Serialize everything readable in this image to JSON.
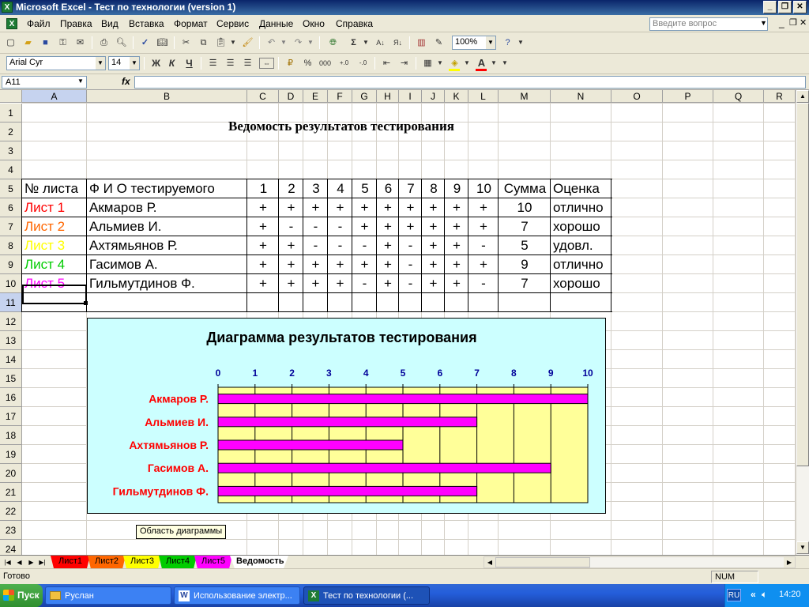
{
  "window": {
    "title": "Microsoft Excel - Тест по технологии  (version 1)"
  },
  "menu": {
    "items": [
      "Файл",
      "Правка",
      "Вид",
      "Вставка",
      "Формат",
      "Сервис",
      "Данные",
      "Окно",
      "Справка"
    ],
    "help_placeholder": "Введите вопрос"
  },
  "toolbar": {
    "zoom": "100%",
    "font": "Arial Cyr",
    "size": "14",
    "bold": "Ж",
    "italic": "К",
    "underline": "Ч",
    "percent": "%",
    "thousands": "000",
    "font_color_letter": "A",
    "sigma": "Σ"
  },
  "formula_bar": {
    "name_box": "A11",
    "fx": "fx",
    "content": ""
  },
  "columns": [
    "A",
    "B",
    "C",
    "D",
    "E",
    "F",
    "G",
    "H",
    "I",
    "J",
    "K",
    "L",
    "M",
    "N",
    "O",
    "P",
    "Q",
    "R"
  ],
  "rows": [
    "1",
    "2",
    "3",
    "4",
    "5",
    "6",
    "7",
    "8",
    "9",
    "10",
    "11",
    "12",
    "13",
    "14",
    "15",
    "16",
    "17",
    "18",
    "19",
    "20",
    "21",
    "22",
    "23",
    "24"
  ],
  "sheet": {
    "title": "Ведомость результатов тестирования",
    "header": [
      "№ листа",
      "Ф И О тестируемого",
      "1",
      "2",
      "3",
      "4",
      "5",
      "6",
      "7",
      "8",
      "9",
      "10",
      "Сумма",
      "Оценка"
    ],
    "rows": [
      {
        "sheet": "Лист 1",
        "color": "#ff0000",
        "name": "Акмаров Р.",
        "marks": [
          "+",
          "+",
          "+",
          "+",
          "+",
          "+",
          "+",
          "+",
          "+",
          "+"
        ],
        "sum": "10",
        "grade": "отлично"
      },
      {
        "sheet": "Лист 2",
        "color": "#ff6600",
        "name": "Альмиев И.",
        "marks": [
          "+",
          "-",
          "-",
          "-",
          "+",
          "+",
          "+",
          "+",
          "+",
          "+"
        ],
        "sum": "7",
        "grade": "хорошо"
      },
      {
        "sheet": "Лист 3",
        "color": "#ffff00",
        "name": "Ахтямьянов Р.",
        "marks": [
          "+",
          "+",
          "-",
          "-",
          "-",
          "+",
          "-",
          "+",
          "+",
          "-"
        ],
        "sum": "5",
        "grade": "удовл."
      },
      {
        "sheet": "Лист 4",
        "color": "#00cc00",
        "name": "Гасимов А.",
        "marks": [
          "+",
          "+",
          "+",
          "+",
          "+",
          "+",
          "-",
          "+",
          "+",
          "+"
        ],
        "sum": "9",
        "grade": "отлично"
      },
      {
        "sheet": "Лист 5",
        "color": "#ff00ff",
        "name": "Гильмутдинов Ф.",
        "marks": [
          "+",
          "+",
          "+",
          "+",
          "-",
          "+",
          "-",
          "+",
          "+",
          "-"
        ],
        "sum": "7",
        "grade": "хорошо"
      }
    ]
  },
  "chart_data": {
    "type": "bar",
    "title": "Диаграмма результатов тестирования",
    "categories": [
      "Акмаров Р.",
      "Альмиев И.",
      "Ахтямьянов Р.",
      "Гасимов А.",
      "Гильмутдинов Ф."
    ],
    "values": [
      10,
      7,
      5,
      9,
      7
    ],
    "xlim": [
      0,
      10
    ],
    "ticks": [
      "0",
      "1",
      "2",
      "3",
      "4",
      "5",
      "6",
      "7",
      "8",
      "9",
      "10"
    ],
    "bar_color": "#ff00ff",
    "plot_bg": "#ffff99",
    "chart_bg": "#ccffff",
    "tick_color": "#000099",
    "label_color": "#ff0000",
    "grid": true,
    "tooltip": "Область диаграммы"
  },
  "sheet_tabs": [
    {
      "label": "Лист1",
      "color": "#ff0000"
    },
    {
      "label": "Лист2",
      "color": "#ff6600"
    },
    {
      "label": "Лист3",
      "color": "#ffff00"
    },
    {
      "label": "Лист4",
      "color": "#00cc00"
    },
    {
      "label": "Лист5",
      "color": "#ff00ff"
    },
    {
      "label": "Ведомость",
      "color": "#ffffff"
    }
  ],
  "status": {
    "left": "Готово",
    "num": "NUM"
  },
  "taskbar": {
    "start": "Пуск",
    "tasks": [
      "Руслан",
      "Использование электр...",
      "Тест по технологии (..."
    ],
    "lang": "RU",
    "clock": "14:20"
  }
}
